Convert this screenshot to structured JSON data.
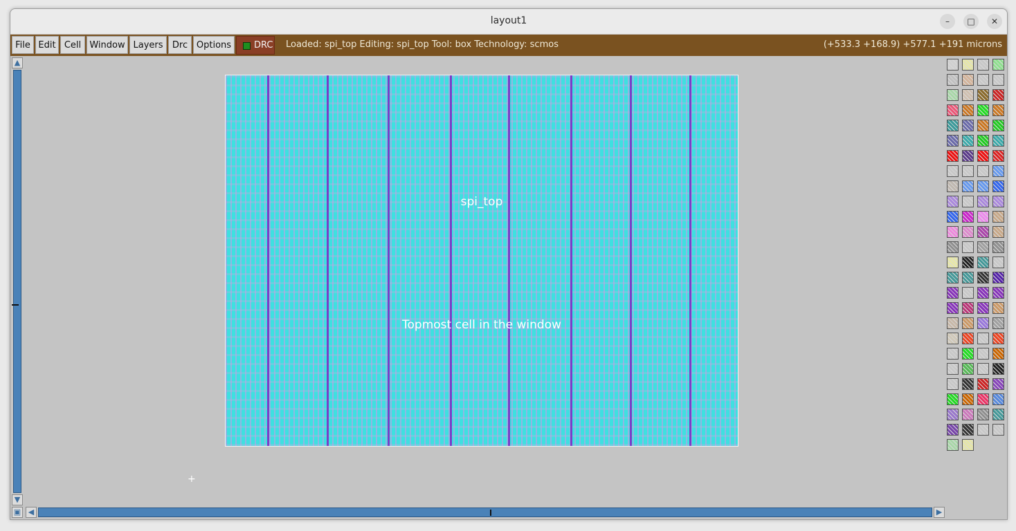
{
  "window": {
    "title": "layout1"
  },
  "window_controls": {
    "minimize": "–",
    "maximize": "□",
    "close": "✕"
  },
  "menu": {
    "items": [
      "File",
      "Edit",
      "Cell",
      "Window",
      "Layers",
      "Drc",
      "Options"
    ]
  },
  "drc_button": {
    "label": "DRC"
  },
  "status": {
    "text": "Loaded: spi_top Editing: spi_top Tool: box  Technology: scmos"
  },
  "coordinates": {
    "text": "(+533.3 +168.9) +577.1 +191 microns"
  },
  "canvas": {
    "cell_name": "spi_top",
    "cell_description": "Topmost cell in the window",
    "layer_colors": {
      "diffusion": "#3ee0e0",
      "poly": "#d296e6",
      "metal_rail": "#7a3ec8"
    }
  },
  "scrollbars": {
    "up_icon": "arrow-up-icon",
    "down_icon": "arrow-down-icon",
    "left_icon": "arrow-left-icon",
    "right_icon": "arrow-right-icon",
    "zoom_icon": "zoom-box-icon"
  },
  "palette": {
    "swatches": [
      "#d0d0d0",
      "#e6e6a8",
      "#c8c8c8",
      "#8ee08e",
      "#c0c0c0",
      "#d4b49a",
      "#c8c8c8",
      "#c8c8c8",
      "#a8d8a8",
      "#d0c0b0",
      "#8a6a2a",
      "#cc2222",
      "#ee5577",
      "#cc7722",
      "#22dd22",
      "#cc7722",
      "#3a9a9a",
      "#6a6aaa",
      "#cc7722",
      "#22cc22",
      "#6a6aaa",
      "#3aaaaa",
      "#22cc22",
      "#3aaaaa",
      "#ee1111",
      "#5a3a8a",
      "#ee1111",
      "#dd2222",
      "#c8c8c8",
      "#c8c8c8",
      "#c8c8c8",
      "#6699ee",
      "#c0b8b0",
      "#6699ee",
      "#6699ee",
      "#3366ee",
      "#aa88dd",
      "#c8c8c8",
      "#aa88dd",
      "#aa88dd",
      "#3366ee",
      "#cc22cc",
      "#ee88ee",
      "#c8a888",
      "#ee88dd",
      "#dd88cc",
      "#aa44aa",
      "#c8a888",
      "#909090",
      "#c8c8c8",
      "#a0a0a0",
      "#909090",
      "#e8e8a8",
      "#222222",
      "#449999",
      "#c8c8c8",
      "#449999",
      "#449999",
      "#333333",
      "#5522aa",
      "#8833bb",
      "#c8c8c8",
      "#8833bb",
      "#8833bb",
      "#8833bb",
      "#bb3377",
      "#8833bb",
      "#cc9966",
      "#c8b8a8",
      "#cc9966",
      "#9977dd",
      "#a0a0a0",
      "#d0c8b8",
      "#ee4422",
      "#c8c8c8",
      "#ee4422",
      "#c8c8c8",
      "#22dd22",
      "#c8c8c8",
      "#cc6600",
      "#c8c8c8",
      "#55bb55",
      "#c8c8c8",
      "#222222",
      "#c8c8c8",
      "#333333",
      "#cc2222",
      "#8844bb",
      "#22dd22",
      "#cc6600",
      "#ee3366",
      "#5588dd",
      "#9977cc",
      "#cc77bb",
      "#909090",
      "#449999",
      "#7744aa",
      "#333333",
      "#c8c8c8",
      "#c8c8c8",
      "#a8d8a8",
      "#e6e6a8"
    ]
  }
}
